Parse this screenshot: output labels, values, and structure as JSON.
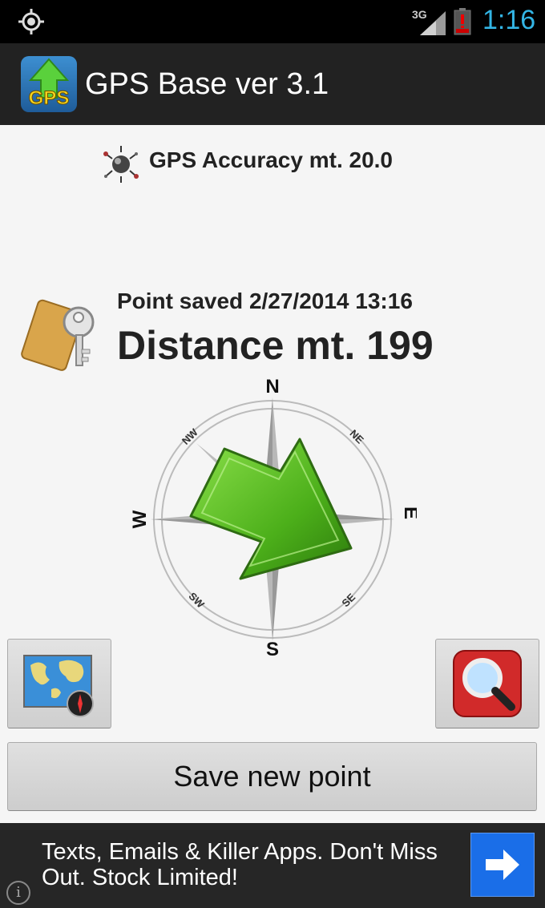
{
  "status_bar": {
    "network": "3G",
    "time": "1:16"
  },
  "action_bar": {
    "title": "GPS Base ver 3.1",
    "icon_text": "GPS"
  },
  "accuracy": {
    "text": "GPS Accuracy mt. 20.0"
  },
  "point": {
    "saved_text": "Point saved 2/27/2014 13:16",
    "distance_text": "Distance mt. 199"
  },
  "compass": {
    "labels": {
      "n": "N",
      "s": "S",
      "e": "E",
      "w": "W",
      "ne": "NE",
      "nw": "NW",
      "se": "SE",
      "sw": "SW"
    }
  },
  "buttons": {
    "save_label": "Save new point"
  },
  "ad": {
    "text": "Texts, Emails & Killer Apps. Don't Miss Out. Stock Limited!",
    "info_glyph": "i"
  },
  "colors": {
    "accent": "#33b5e5",
    "arrow_green": "#4caf1a",
    "ad_button": "#1a6ee8"
  }
}
